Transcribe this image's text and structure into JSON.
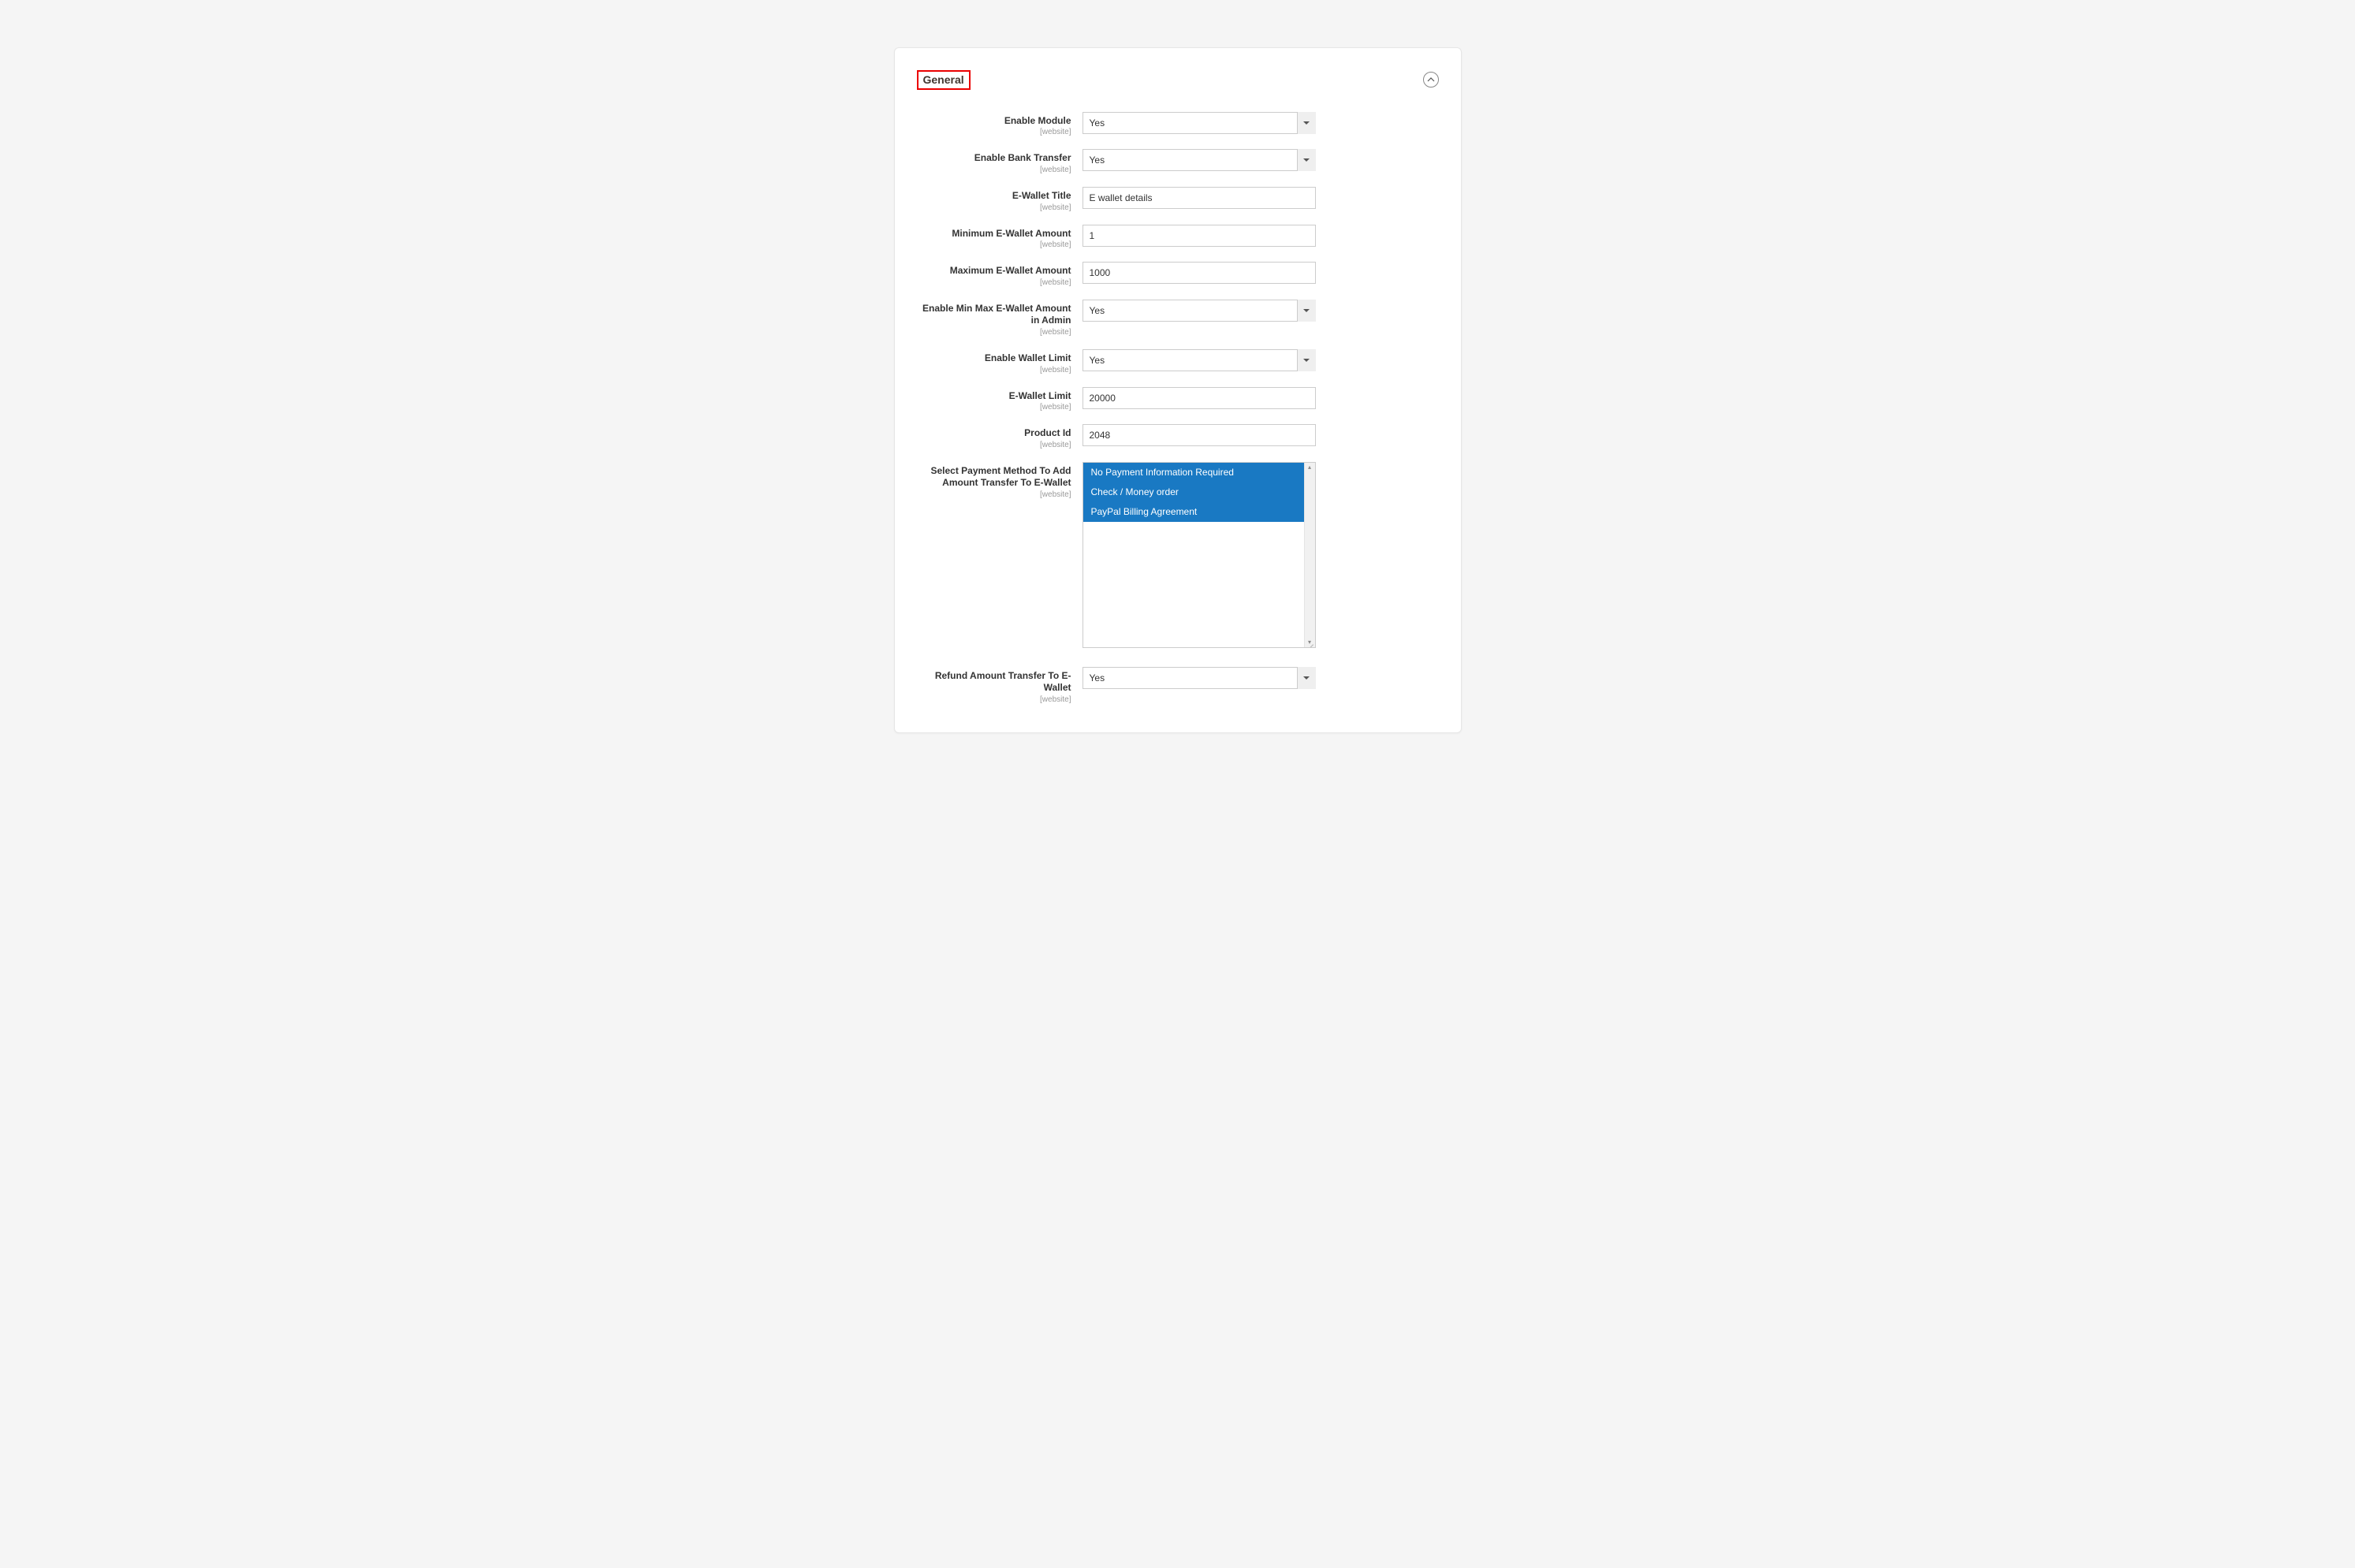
{
  "section": {
    "title": "General",
    "scope_label": "[website]"
  },
  "fields": {
    "enable_module": {
      "label": "Enable Module",
      "value": "Yes",
      "type": "select"
    },
    "enable_bank_transfer": {
      "label": "Enable Bank Transfer",
      "value": "Yes",
      "type": "select"
    },
    "ewallet_title": {
      "label": "E-Wallet Title",
      "value": "E wallet details",
      "type": "text"
    },
    "min_amount": {
      "label": "Minimum E-Wallet Amount",
      "value": "1",
      "type": "text"
    },
    "max_amount": {
      "label": "Maximum E-Wallet Amount",
      "value": "1000",
      "type": "text"
    },
    "enable_minmax_admin": {
      "label": "Enable Min Max E-Wallet Amount in Admin",
      "value": "Yes",
      "type": "select"
    },
    "enable_wallet_limit": {
      "label": "Enable Wallet Limit",
      "value": "Yes",
      "type": "select"
    },
    "ewallet_limit": {
      "label": "E-Wallet Limit",
      "value": "20000",
      "type": "text"
    },
    "product_id": {
      "label": "Product Id",
      "value": "2048",
      "type": "text"
    },
    "payment_methods": {
      "label": "Select Payment Method To Add Amount Transfer To E-Wallet",
      "options": [
        "No Payment Information Required",
        "Check / Money order",
        "PayPal Billing Agreement"
      ],
      "type": "multiselect"
    },
    "refund_transfer": {
      "label": "Refund Amount Transfer To E-Wallet",
      "value": "Yes",
      "type": "select"
    }
  }
}
